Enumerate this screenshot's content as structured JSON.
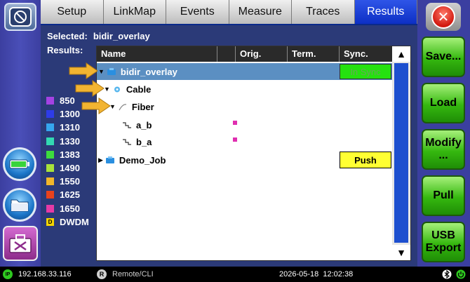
{
  "tabs": [
    {
      "label": "Setup",
      "active": false
    },
    {
      "label": "LinkMap",
      "active": false
    },
    {
      "label": "Events",
      "active": false
    },
    {
      "label": "Measure",
      "active": false
    },
    {
      "label": "Traces",
      "active": false
    },
    {
      "label": "Results",
      "active": true
    }
  ],
  "selected": {
    "label": "Selected:",
    "value": "bidir_overlay"
  },
  "results_label": "Results:",
  "table": {
    "columns": [
      "Name",
      "",
      "Orig.",
      "Term.",
      "Sync."
    ],
    "rows": [
      {
        "name": "bidir_overlay",
        "sync": "In Sync",
        "selected": true
      },
      {
        "name": "Cable"
      },
      {
        "name": "Fiber"
      },
      {
        "name": "a_b"
      },
      {
        "name": "b_a"
      },
      {
        "name": "Demo_Job",
        "sync": "Push"
      }
    ],
    "scroll_up": "▲",
    "scroll_down": "▼"
  },
  "legend": [
    {
      "label": "850",
      "color": "#a442e3"
    },
    {
      "label": "1300",
      "color": "#2e3ce8"
    },
    {
      "label": "1310",
      "color": "#35a6ee"
    },
    {
      "label": "1330",
      "color": "#33d9b2"
    },
    {
      "label": "1383",
      "color": "#3ddc3d"
    },
    {
      "label": "1490",
      "color": "#a7e23a"
    },
    {
      "label": "1550",
      "color": "#f0b62a"
    },
    {
      "label": "1625",
      "color": "#e8421c"
    },
    {
      "label": "1650",
      "color": "#e63aa6"
    },
    {
      "label": "DWDM",
      "color": "#f5d400",
      "badge": "D"
    }
  ],
  "right_buttons": {
    "save": "Save...",
    "load": "Load",
    "modify_line1": "Modify",
    "modify_line2": "...",
    "pull": "Pull",
    "usb_line1": "USB",
    "usb_line2": "Export"
  },
  "close_glyph": "✕",
  "status": {
    "ip_badge": "IP",
    "ip": "192.168.33.116",
    "remote_badge": "R",
    "remote": "Remote/CLI",
    "datetime": "2026-05-18  12:02:38"
  },
  "colors": {
    "accent_tab": "#0d2fc4",
    "green_button": "#35b80f",
    "selection": "#5b8fc2",
    "in_sync": "#25e10f",
    "push": "#ffff33",
    "callout_arrow": "#f2b431"
  }
}
